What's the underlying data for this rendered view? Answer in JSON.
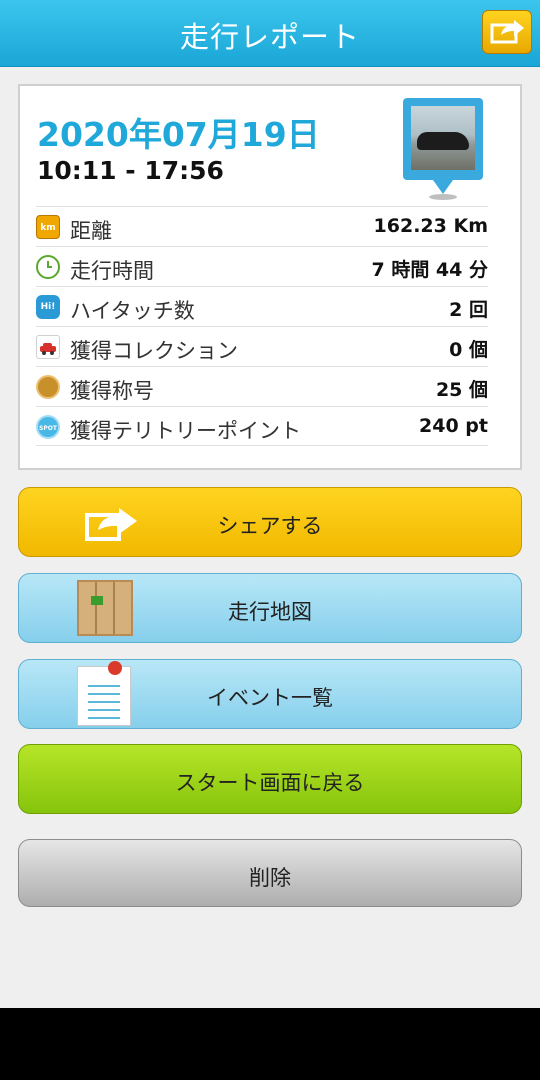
{
  "header": {
    "title": "走行レポート",
    "share_icon": "share-arrow-icon"
  },
  "report": {
    "date": "2020年07月19日",
    "time_range": "10:11 - 17:56",
    "photo_icon": "car-photo-pin",
    "stats": [
      {
        "icon": "km-icon",
        "icon_text": "km",
        "label": "距離",
        "value": "162.23 Km"
      },
      {
        "icon": "clock-icon",
        "icon_text": "",
        "label": "走行時間",
        "value": "7 時間 44 分"
      },
      {
        "icon": "hand-icon",
        "icon_text": "Hi!",
        "label": "ハイタッチ数",
        "value": "2 回"
      },
      {
        "icon": "collection-car-icon",
        "icon_text": "",
        "label": "獲得コレクション",
        "value": "0 個"
      },
      {
        "icon": "title-badge-icon",
        "icon_text": "",
        "label": "獲得称号",
        "value": "25 個"
      },
      {
        "icon": "spot-icon",
        "icon_text": "SPOT",
        "label": "獲得テリトリーポイント",
        "value": "240 pt"
      }
    ]
  },
  "buttons": {
    "share": "シェアする",
    "map": "走行地図",
    "events": "イベント一覧",
    "start": "スタート画面に戻る",
    "delete": "削除"
  },
  "colors": {
    "header": "#1aa6d6",
    "accent_text": "#1fa8d9",
    "share_button": "#f2b800",
    "map_button": "#86cfec",
    "start_button": "#86c40c",
    "delete_button": "#aeaeae"
  }
}
